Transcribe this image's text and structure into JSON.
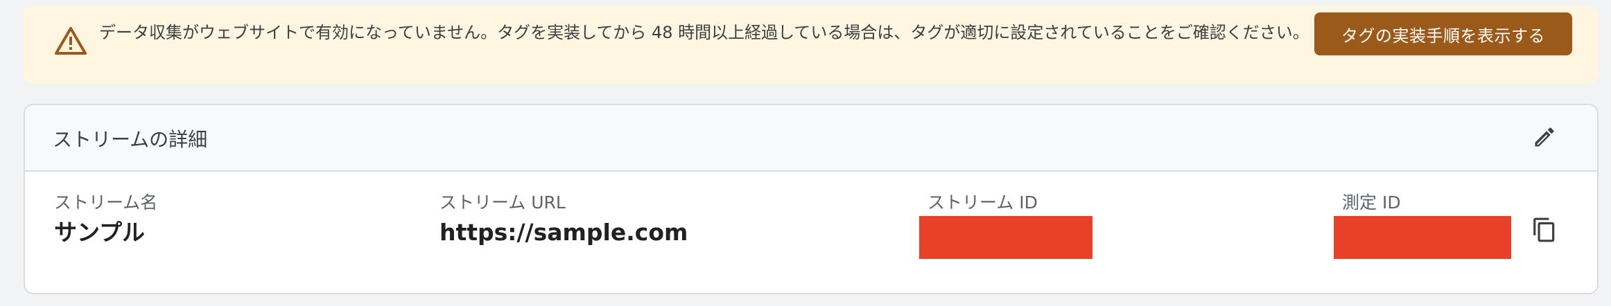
{
  "banner": {
    "icon": "warning-icon",
    "message": "データ収集がウェブサイトで有効になっていません。タグを実装してから 48 時間以上経過している場合は、タグが適切に設定されていることをご確認ください。",
    "button_label": "タグの実装手順を表示する",
    "colors": {
      "background": "#fef6e0",
      "button": "#9c5a1a",
      "icon": "#9c5a1a"
    }
  },
  "stream_details": {
    "title": "ストリームの詳細",
    "edit_icon": "pencil-icon",
    "copy_icon": "copy-icon",
    "fields": [
      {
        "label": "ストリーム名",
        "value": "サンプル"
      },
      {
        "label": "ストリーム URL",
        "value": "https://sample.com"
      },
      {
        "label": "ストリーム ID",
        "value": ""
      },
      {
        "label": "測定 ID",
        "value": ""
      }
    ],
    "redaction_color": "#e84128"
  }
}
